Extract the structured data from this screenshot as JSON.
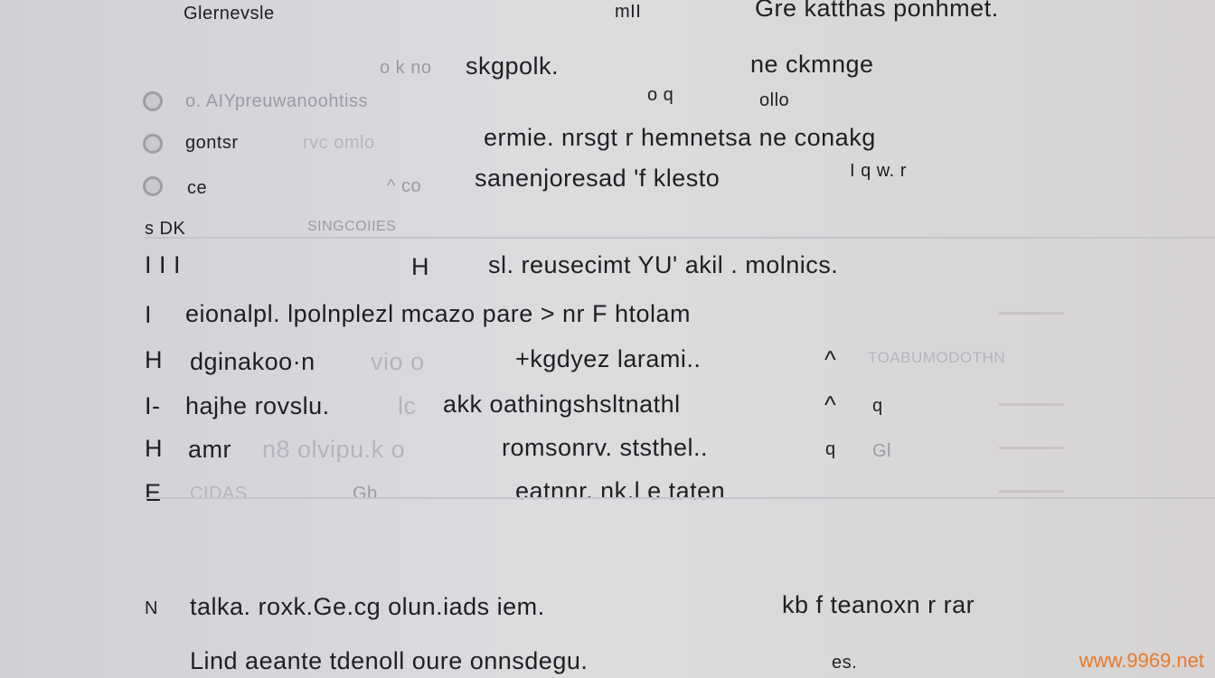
{
  "header": {
    "left": "Glernevsle",
    "middle": "mII",
    "right": "Gre katthas ponhmet."
  },
  "subheader": {
    "faded": "o k no",
    "title": "skgpolk.",
    "right": "ne ckmnge"
  },
  "options": [
    {
      "label": "o. AIYpreuwanoohtiss",
      "mid": "o q",
      "right": "ollo"
    },
    {
      "label": "gontsr",
      "faded": "rvc omlo",
      "text": "ermie. nrsgt r hemnetsa ne conakg"
    },
    {
      "label": "ce",
      "faded": "^ co",
      "text": "sanenjoresad 'f klesto",
      "right": "I q w. r"
    }
  ],
  "section": {
    "left": "s DK",
    "label": "SINGCOIIES"
  },
  "table_header": {
    "marks": "I  I  I",
    "h": "H",
    "text": "sl. reusecimt  YU'  akil  .  molnics."
  },
  "rows": [
    {
      "mark": "I",
      "text": "eionalpl. lpolnplezl mcazo pare > nr F htolam"
    },
    {
      "mark": "H",
      "text": "dginakoo·n",
      "faded": "vio o",
      "text2": "+kgdyez larami..",
      "caret": "^",
      "right": "TOABUMODOTHN"
    },
    {
      "mark": "I-",
      "text": "hajhe rovslu.",
      "faded": "lc",
      "text2": "akk oathingshsltnathl",
      "caret": "^",
      "extra": "q"
    },
    {
      "mark": "H",
      "text": "amr",
      "faded": "n8 olvipu.k o",
      "text2": "romsonrv. ststhel..",
      "caret": "q",
      "extra": "Gl"
    },
    {
      "mark": "E",
      "faded": "CIDAS",
      "text": "Gb",
      "text2": "eatnnr. nk.l  e  taten"
    }
  ],
  "footer": [
    {
      "mark": "N",
      "text": "talka.  roxk.Ge.cg  olun.iads  iem.",
      "right": "kb  f  teanoxn r rar"
    },
    {
      "mark": "",
      "text": "Lind aeante  tdenoll oure  onnsdegu.",
      "right": "es."
    }
  ],
  "watermark": "www.9969.net"
}
